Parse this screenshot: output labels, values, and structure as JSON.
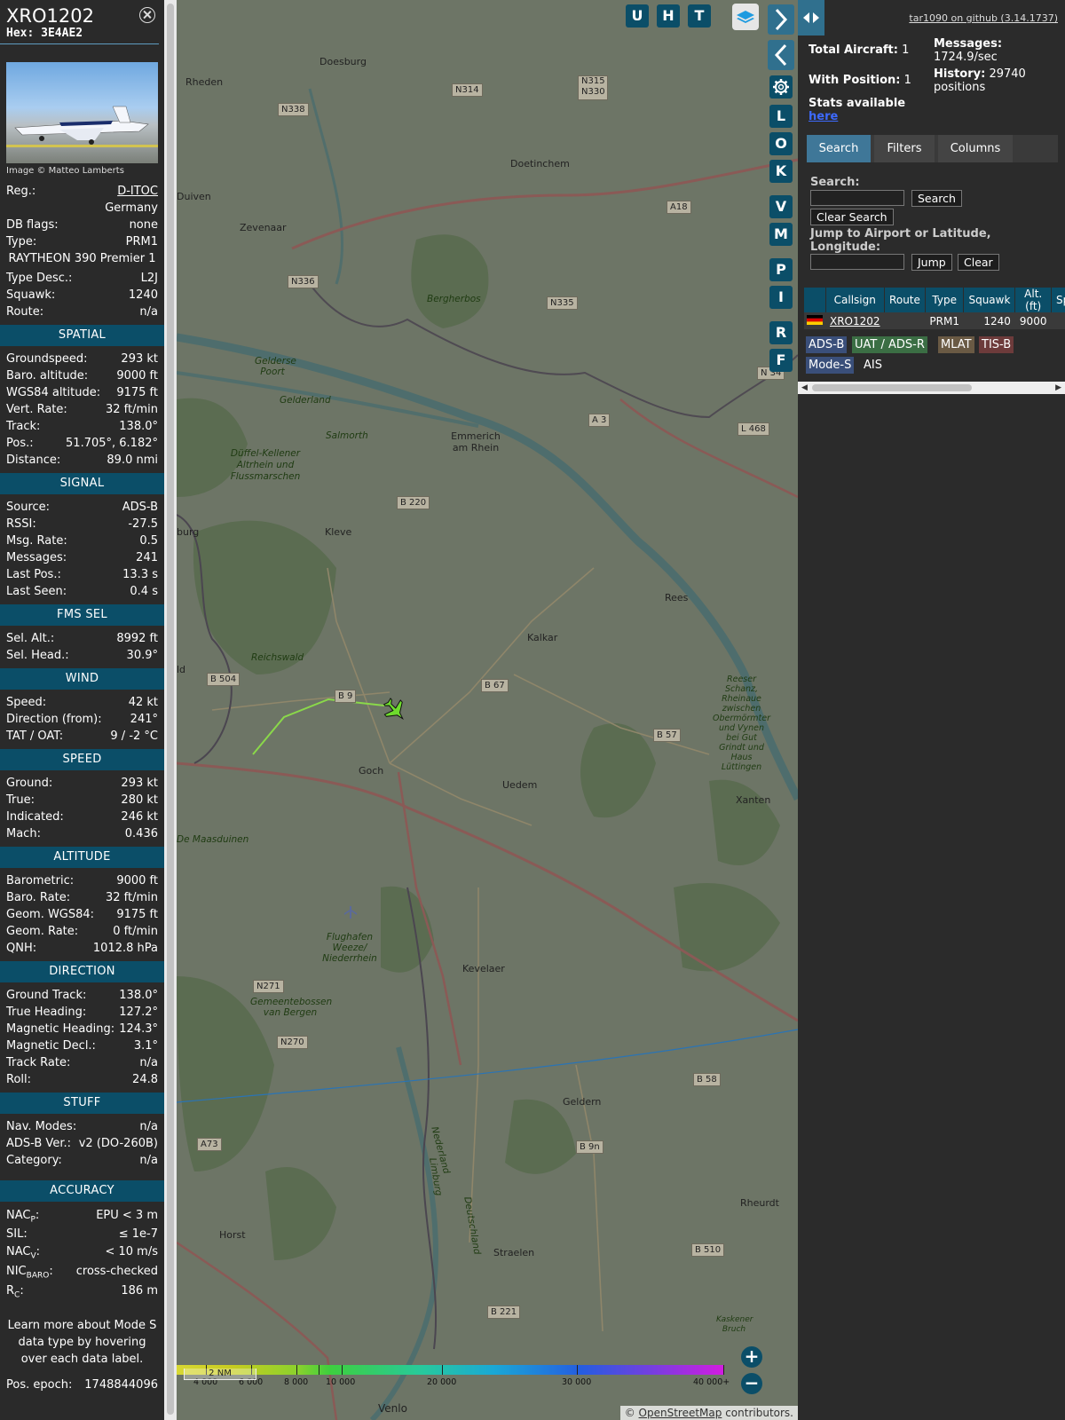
{
  "selected": {
    "callsign": "XRO1202",
    "hex": "Hex: 3E4AE2",
    "image_credit": "Image © Matteo Lamberts",
    "reg_label": "Reg.:",
    "reg_value": "D-ITOC",
    "country": "Germany",
    "dbflags_label": "DB flags:",
    "dbflags_value": "none",
    "type_label": "Type:",
    "type_value": "PRM1",
    "type_name": "RAYTHEON 390 Premier 1",
    "typedesc_label": "Type Desc.:",
    "typedesc_value": "L2J",
    "squawk_label": "Squawk:",
    "squawk_value": "1240",
    "route_label": "Route:",
    "route_value": "n/a"
  },
  "sections": [
    {
      "title": "SPATIAL",
      "rows": [
        {
          "k": "Groundspeed:",
          "v": "293 kt"
        },
        {
          "k": "Baro. altitude:",
          "v": "9000 ft"
        },
        {
          "k": "WGS84 altitude:",
          "v": "9175 ft"
        },
        {
          "k": "Vert. Rate:",
          "v": "32 ft/min"
        },
        {
          "k": "Track:",
          "v": "138.0°"
        },
        {
          "k": "Pos.:",
          "v": "51.705°, 6.182°"
        },
        {
          "k": "Distance:",
          "v": "89.0 nmi"
        }
      ]
    },
    {
      "title": "SIGNAL",
      "rows": [
        {
          "k": "Source:",
          "v": "ADS-B"
        },
        {
          "k": "RSSI:",
          "v": "-27.5"
        },
        {
          "k": "Msg. Rate:",
          "v": "0.5"
        },
        {
          "k": "Messages:",
          "v": "241"
        },
        {
          "k": "Last Pos.:",
          "v": "13.3 s"
        },
        {
          "k": "Last Seen:",
          "v": "0.4 s"
        }
      ]
    },
    {
      "title": "FMS SEL",
      "rows": [
        {
          "k": "Sel. Alt.:",
          "v": "8992 ft"
        },
        {
          "k": "Sel. Head.:",
          "v": "30.9°"
        }
      ]
    },
    {
      "title": "WIND",
      "rows": [
        {
          "k": "Speed:",
          "v": "42 kt"
        },
        {
          "k": "Direction (from):",
          "v": "241°"
        },
        {
          "k": "TAT / OAT:",
          "v": "9 / -2 °C"
        }
      ]
    },
    {
      "title": "SPEED",
      "rows": [
        {
          "k": "Ground:",
          "v": "293 kt"
        },
        {
          "k": "True:",
          "v": "280 kt"
        },
        {
          "k": "Indicated:",
          "v": "246 kt"
        },
        {
          "k": "Mach:",
          "v": "0.436"
        }
      ]
    },
    {
      "title": "ALTITUDE",
      "rows": [
        {
          "k": "Barometric:",
          "v": "9000 ft"
        },
        {
          "k": "Baro. Rate:",
          "v": "32 ft/min"
        },
        {
          "k": "Geom. WGS84:",
          "v": "9175 ft"
        },
        {
          "k": "Geom. Rate:",
          "v": "0 ft/min"
        },
        {
          "k": "QNH:",
          "v": "1012.8 hPa"
        }
      ]
    },
    {
      "title": "DIRECTION",
      "rows": [
        {
          "k": "Ground Track:",
          "v": "138.0°"
        },
        {
          "k": "True Heading:",
          "v": "127.2°"
        },
        {
          "k": "Magnetic Heading:",
          "v": "124.3°"
        },
        {
          "k": "Magnetic Decl.:",
          "v": "3.1°"
        },
        {
          "k": "Track Rate:",
          "v": "n/a"
        },
        {
          "k": "Roll:",
          "v": "24.8"
        }
      ]
    },
    {
      "title": "STUFF",
      "rows": [
        {
          "k": "Nav. Modes:",
          "v": "n/a"
        },
        {
          "k": "ADS-B Ver.:",
          "v": "v2 (DO-260B)"
        },
        {
          "k": "Category:",
          "v": "n/a"
        }
      ]
    }
  ],
  "accuracy": {
    "title": "ACCURACY",
    "nacp_k": "NAC",
    "nacp_sub": "P",
    "nacp_v": "EPU < 3 m",
    "sil_k": "SIL:",
    "sil_v": "≤ 1e-7",
    "nacv_k": "NAC",
    "nacv_sub": "V",
    "nacv_v": "< 10 m/s",
    "nicbaro_k": "NIC",
    "nicbaro_sub": "BARO",
    "nicbaro_v": "cross-checked",
    "rc_k": "R",
    "rc_sub": "C",
    "rc_v": "186 m"
  },
  "learn_more": "Learn more about Mode S data type by hovering over each data label.",
  "pos_epoch_label": "Pos. epoch:",
  "pos_epoch_value": "1748844096",
  "map": {
    "top_buttons": [
      "U",
      "H",
      "T"
    ],
    "side_buttons": [
      "L",
      "O",
      "K",
      "V",
      "M",
      "P",
      "I",
      "R",
      "F"
    ],
    "scale": "2 NM",
    "legend_ticks": [
      "4 000",
      "6 000",
      "8 000",
      "10 000",
      "20 000",
      "30 000",
      "40 000+"
    ],
    "attribution_prefix": "©",
    "attribution_link": "OpenStreetMap",
    "attribution_suffix": "contributors.",
    "places": [
      "Doesburg",
      "Rheden",
      "Duiven",
      "Zevenaar",
      "Doetinchem",
      "Bergherbos",
      "Emmerich am Rhein",
      "Gelderse Poort",
      "Gelderland",
      "Salmorth",
      "Düffel-Kellener Altrhein und Flussmarschen",
      "Kleve",
      "Rees",
      "Kalkar",
      "Reichswald",
      "Goch",
      "Uedem",
      "Xanten",
      "Reeser Schanz, Rheinaue zwischen Obermörmter und Vynen bei Gut Grindt und Haus Lüttingen",
      "De Maasduinen",
      "Flughafen Weeze/ Niederrhein",
      "Kevelaer",
      "Gemeentebossen van Bergen",
      "Geldern",
      "Rheurdt",
      "Horst",
      "Straelen",
      "Venlo",
      "Kaskener Bruch",
      "Limburg",
      "Nederland",
      "Deutschland",
      "burg",
      "ld"
    ],
    "roads": [
      "N314",
      "N315 N330",
      "N338",
      "A18",
      "N336",
      "N335",
      "A 3",
      "L 468",
      "B 220",
      "B 9",
      "B 67",
      "B 504",
      "B 57",
      "N271",
      "N270",
      "B 58",
      "A73",
      "B 9n",
      "B 510",
      "B 221",
      "N 34"
    ]
  },
  "side": {
    "github": "tar1090 on github (3.14.1737)",
    "total_label": "Total Aircraft:",
    "total_value": "1",
    "withpos_label": "With Position:",
    "withpos_value": "1",
    "stats_label": "Stats available",
    "stats_link": "here",
    "messages_label": "Messages:",
    "messages_value": "1724.9/sec",
    "history_label": "History:",
    "history_value": "29740 positions",
    "tabs": [
      "Search",
      "Filters",
      "Columns"
    ],
    "search_label": "Search:",
    "search_button": "Search",
    "clear_search_button": "Clear Search",
    "jump_label": "Jump to Airport or Latitude, Longitude:",
    "jump_button": "Jump",
    "clear_button": "Clear",
    "columns": [
      "",
      "Callsign",
      "Route",
      "Type",
      "Squawk",
      "Alt. (ft)",
      "Sp"
    ],
    "rows": [
      {
        "flag": "de",
        "callsign": "XRO1202",
        "route": "",
        "type": "PRM1",
        "squawk": "1240",
        "alt": "9000"
      }
    ],
    "badges": [
      "ADS-B",
      "UAT / ADS-R",
      "MLAT",
      "TIS-B",
      "Mode-S",
      "AIS"
    ]
  }
}
